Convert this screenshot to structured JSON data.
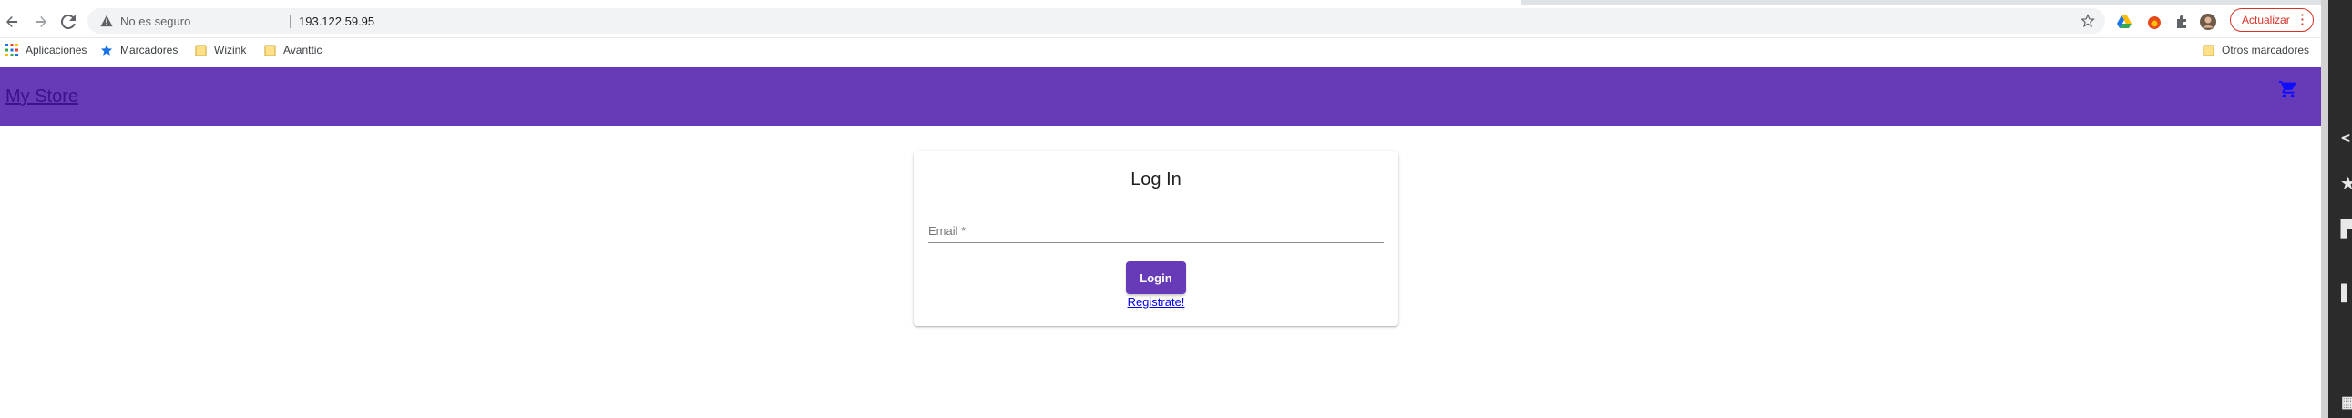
{
  "browser": {
    "security_label": "No es seguro",
    "url": "193.122.59.95",
    "update_button": "Actualizar",
    "bookmarks": [
      "Aplicaciones",
      "Marcadores",
      "Wizink",
      "Avanttic"
    ],
    "other_bookmarks": "Otros marcadores"
  },
  "app": {
    "brand": "My Store",
    "login_card": {
      "title": "Log In",
      "email_placeholder": "Email *",
      "email_value": "",
      "login_button": "Login",
      "register_link": "Registrate!"
    }
  },
  "colors": {
    "primary": "#673ab7",
    "link": "#0000ee",
    "update_accent": "#d93025"
  },
  "icons": [
    "back-arrow-icon",
    "forward-arrow-icon",
    "reload-icon",
    "warning-icon",
    "bookmark-star-icon",
    "cart-icon"
  ]
}
